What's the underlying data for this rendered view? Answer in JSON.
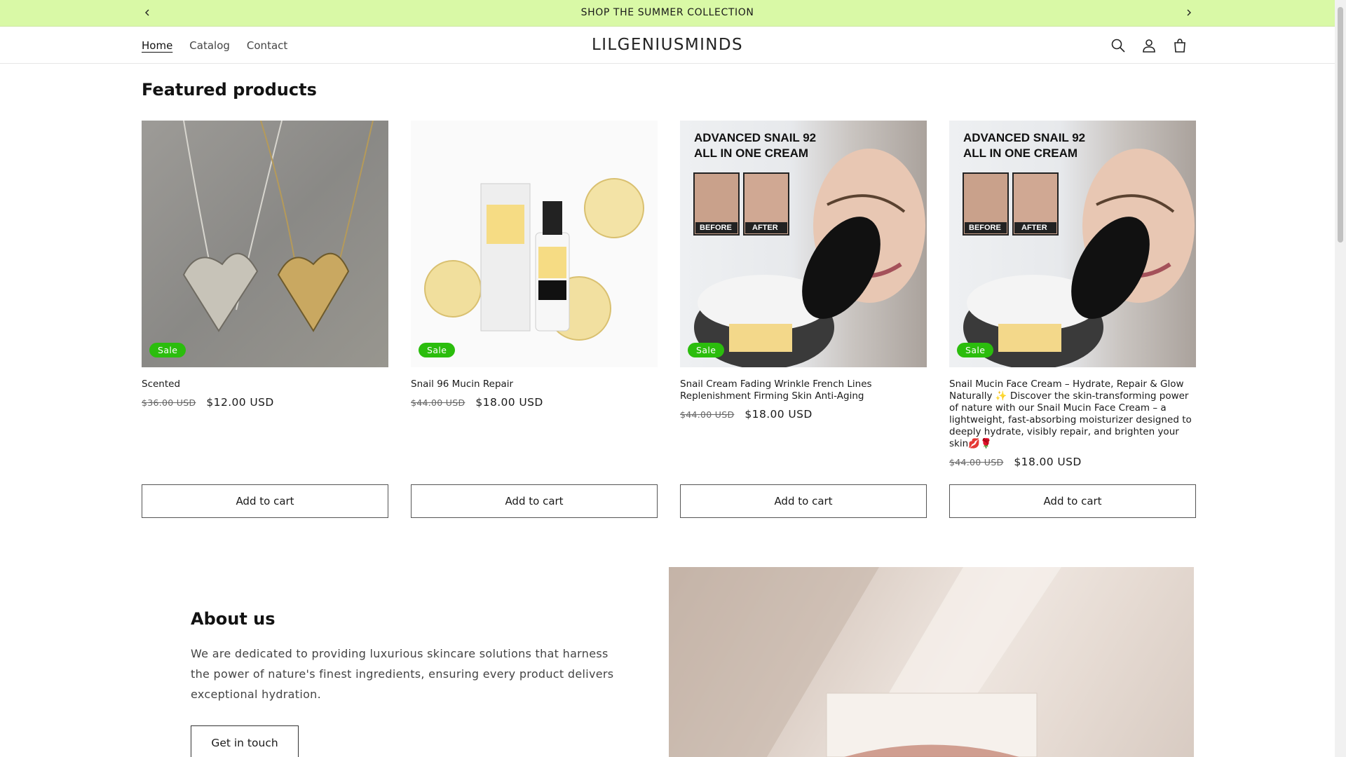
{
  "announcement": {
    "text": "SHOP THE SUMMER COLLECTION"
  },
  "header": {
    "nav": [
      {
        "label": "Home"
      },
      {
        "label": "Catalog"
      },
      {
        "label": "Contact"
      }
    ],
    "logo": "LILGENIUSMINDS",
    "icons": [
      "search-icon",
      "account-icon",
      "cart-icon"
    ]
  },
  "featured": {
    "title": "Featured products",
    "products": [
      {
        "name": "Scented",
        "badge": "Sale",
        "old_price": "$36.00 USD",
        "price": "$12.00 USD",
        "cta": "Add to cart",
        "image_text": []
      },
      {
        "name": "Snail 96 Mucin Repair",
        "badge": "Sale",
        "old_price": "$44.00 USD",
        "price": "$18.00 USD",
        "cta": "Add to cart",
        "image_text": []
      },
      {
        "name": "Snail Cream Fading Wrinkle French Lines Replenishment Firming Skin Anti-Aging",
        "badge": "Sale",
        "old_price": "$44.00 USD",
        "price": "$18.00 USD",
        "cta": "Add to cart",
        "image_text": [
          "ADVANCED SNAIL 92",
          "ALL IN ONE CREAM",
          "BEFORE",
          "AFTER"
        ]
      },
      {
        "name": "Snail Mucin Face Cream – Hydrate, Repair & Glow Naturally ✨ Discover the skin-transforming power of nature with our Snail Mucin Face Cream – a lightweight, fast-absorbing moisturizer designed to deeply hydrate, visibly repair, and brighten your skin💋🌹",
        "badge": "Sale",
        "old_price": "$44.00 USD",
        "price": "$18.00 USD",
        "cta": "Add to cart",
        "image_text": [
          "ADVANCED SNAIL 92",
          "ALL IN ONE CREAM",
          "BEFORE",
          "AFTER"
        ]
      }
    ]
  },
  "about": {
    "title": "About us",
    "text": "We are dedicated to providing luxurious skincare solutions that harness the power of nature's finest ingredients, ensuring every product delivers exceptional hydration.",
    "cta": "Get in touch"
  },
  "colors": {
    "announcement_bg": "#d9f9a6",
    "sale_badge": "#2bbd0d"
  }
}
